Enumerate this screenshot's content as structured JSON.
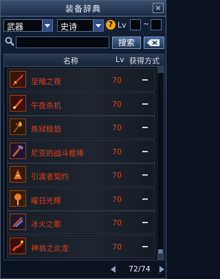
{
  "window": {
    "title": "装备辞典",
    "close_label": "×"
  },
  "filters": {
    "category": "武器",
    "rarity": "史诗",
    "help_label": "?",
    "level_label": "Lv",
    "level_min": "",
    "level_max": "",
    "separator": "~"
  },
  "search": {
    "input_value": "",
    "button_label": "搜索"
  },
  "table": {
    "headers": {
      "name": "名称",
      "level": "Lv",
      "source": "获得方式"
    },
    "rows": [
      {
        "name": "至暗之夜",
        "level": "70",
        "source": "—",
        "icon": "sword-icon"
      },
      {
        "name": "午夜杀机",
        "level": "70",
        "source": "—",
        "icon": "dagger-icon"
      },
      {
        "name": "炼狱极焰",
        "level": "70",
        "source": "—",
        "icon": "flame-staff-icon"
      },
      {
        "name": "尼亚的战斗棍棒",
        "level": "70",
        "source": "—",
        "icon": "club-icon"
      },
      {
        "name": "引渡者契约",
        "level": "70",
        "source": "—",
        "icon": "contract-icon"
      },
      {
        "name": "曜日光辉",
        "level": "70",
        "source": "—",
        "icon": "sun-blade-icon"
      },
      {
        "name": "冰火之歌",
        "level": "70",
        "source": "—",
        "icon": "ice-fire-icon"
      },
      {
        "name": "神翁之炎龙",
        "level": "70",
        "source": "—",
        "icon": "dragon-icon"
      }
    ]
  },
  "pager": {
    "text": "72/74"
  },
  "colors": {
    "item_name": "#e0401a",
    "title_bar": "#3a4f6e",
    "accent_help": "#f0a800"
  }
}
